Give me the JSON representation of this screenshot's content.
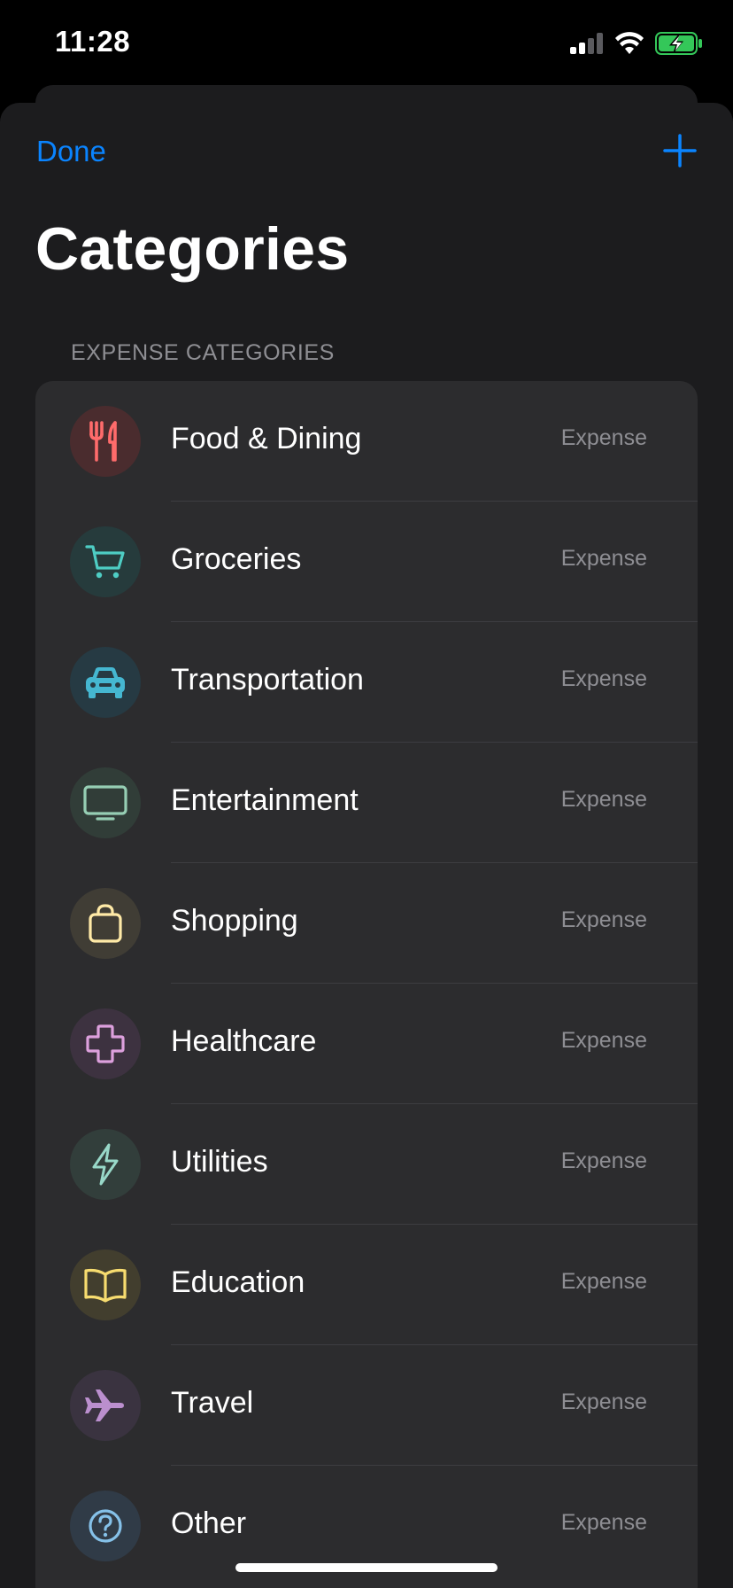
{
  "status_bar": {
    "time": "11:28",
    "icons": [
      "cellular-signal-icon",
      "wifi-icon",
      "battery-charging-icon"
    ]
  },
  "nav": {
    "done_label": "Done",
    "add_icon": "plus-icon"
  },
  "title": "Categories",
  "section": {
    "header": "EXPENSE CATEGORIES",
    "items": [
      {
        "label": "Food & Dining",
        "type": "Expense",
        "icon": "fork-knife-icon",
        "color": "#ff6b6b",
        "bg": "#4a2c2e"
      },
      {
        "label": "Groceries",
        "type": "Expense",
        "icon": "cart-icon",
        "color": "#4ecdc4",
        "bg": "#263b3c"
      },
      {
        "label": "Transportation",
        "type": "Expense",
        "icon": "car-icon",
        "color": "#45b7d1",
        "bg": "#263a43"
      },
      {
        "label": "Entertainment",
        "type": "Expense",
        "icon": "tv-icon",
        "color": "#96ceb4",
        "bg": "#313d38"
      },
      {
        "label": "Shopping",
        "type": "Expense",
        "icon": "bag-icon",
        "color": "#ffeaa7",
        "bg": "#403d35"
      },
      {
        "label": "Healthcare",
        "type": "Expense",
        "icon": "cross-icon",
        "color": "#dda0dd",
        "bg": "#3d3240"
      },
      {
        "label": "Utilities",
        "type": "Expense",
        "icon": "bolt-icon",
        "color": "#98d8c8",
        "bg": "#323e3b"
      },
      {
        "label": "Education",
        "type": "Expense",
        "icon": "book-icon",
        "color": "#f7dc6f",
        "bg": "#423e2e"
      },
      {
        "label": "Travel",
        "type": "Expense",
        "icon": "airplane-icon",
        "color": "#bb8fce",
        "bg": "#3a3340"
      },
      {
        "label": "Other",
        "type": "Expense",
        "icon": "question-icon",
        "color": "#85c1e9",
        "bg": "#303b47"
      }
    ]
  },
  "colors": {
    "accent": "#0a84ff",
    "background": "#000000",
    "sheet": "#1c1c1e",
    "row": "#2c2c2e",
    "secondary_text": "#8e8e93"
  }
}
